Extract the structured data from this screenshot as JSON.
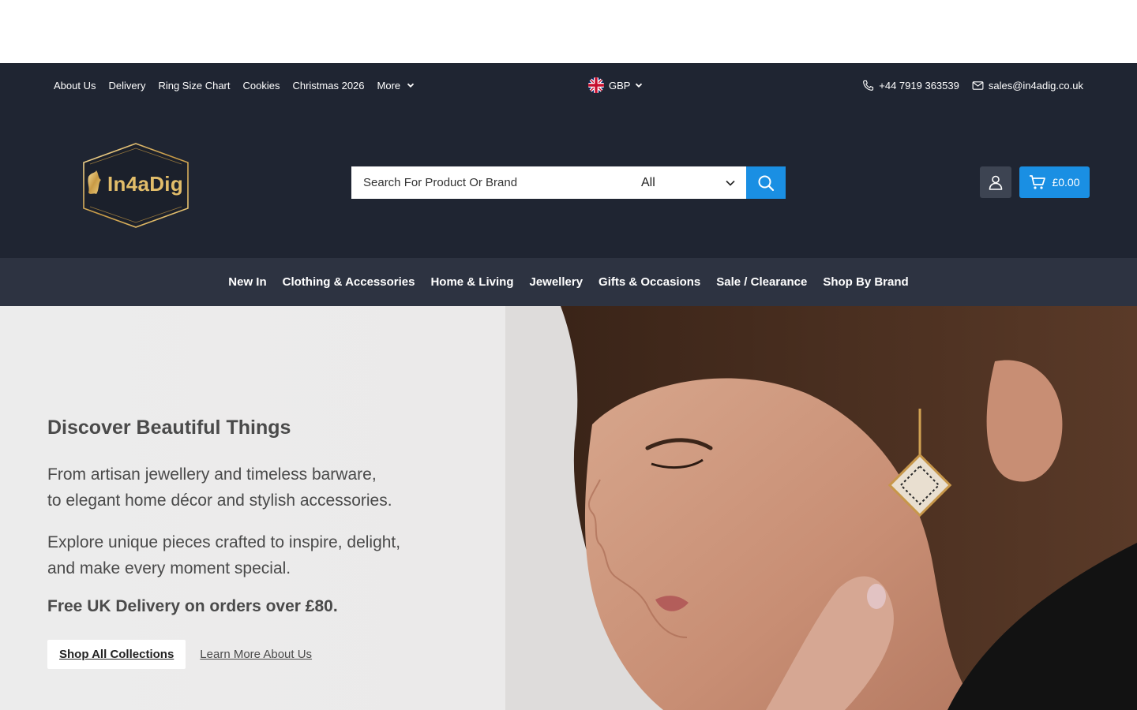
{
  "utility": {
    "links": [
      "About Us",
      "Delivery",
      "Ring Size Chart",
      "Cookies",
      "Christmas 2026"
    ],
    "more_label": "More",
    "currency": "GBP",
    "phone": "+44 7919 363539",
    "email": "sales@in4adig.co.uk"
  },
  "logo": {
    "text": "In4aDig"
  },
  "search": {
    "placeholder": "Search For Product Or Brand",
    "category": "All"
  },
  "cart": {
    "total": "£0.00"
  },
  "nav": [
    "New In",
    "Clothing & Accessories",
    "Home & Living",
    "Jewellery",
    "Gifts & Occasions",
    "Sale / Clearance",
    "Shop By Brand"
  ],
  "hero": {
    "title": "Discover Beautiful Things",
    "p1_line1": "From artisan jewellery and timeless barware,",
    "p1_line2": "to elegant home décor and stylish accessories.",
    "p2_line1": "Explore unique pieces crafted to inspire, delight,",
    "p2_line2": "and make every moment special.",
    "delivery": "Free UK Delivery on orders over £80.",
    "cta_primary": "Shop All Collections",
    "cta_secondary": "Learn More About Us"
  },
  "colors": {
    "header_bg": "#1f2532",
    "nav_bg": "#2d3341",
    "accent": "#1a8fe3",
    "logo_gold": "#e2bd6a"
  }
}
